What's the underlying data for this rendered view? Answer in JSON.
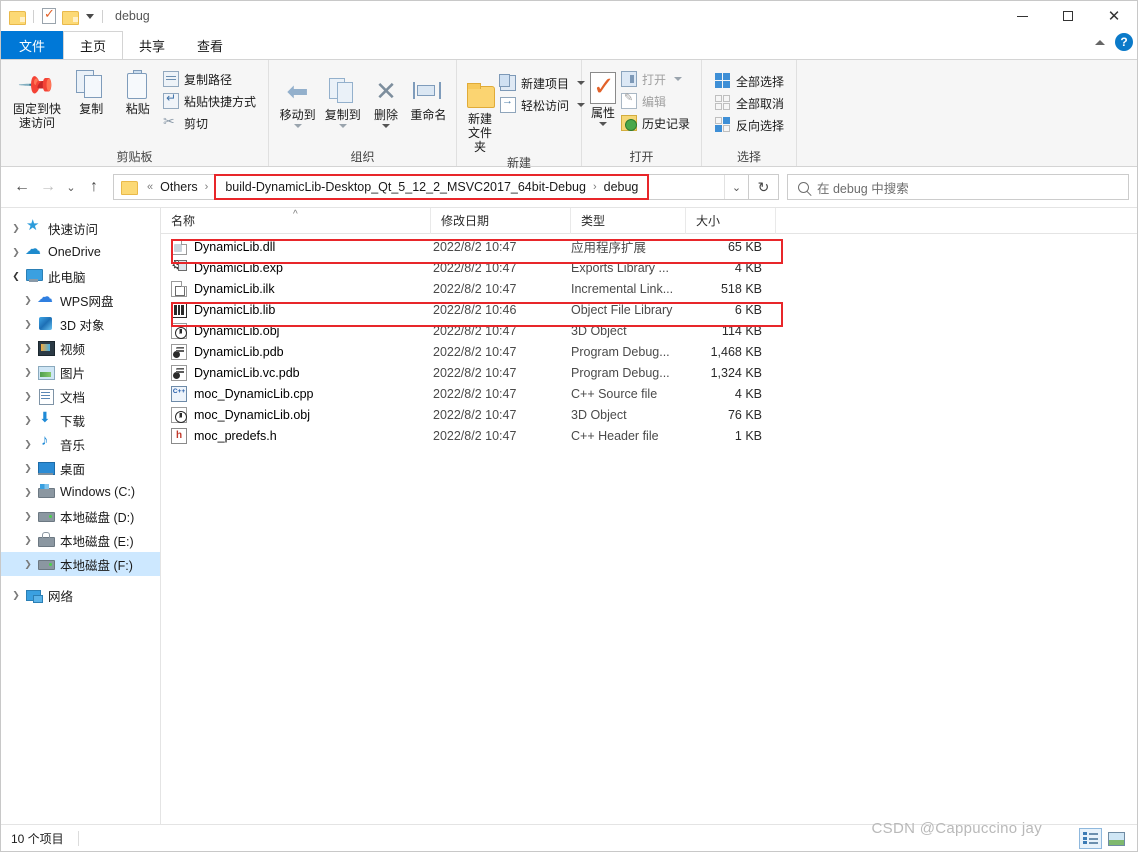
{
  "window": {
    "title": "debug",
    "quick_access_icons": [
      "folder-icon",
      "properties-icon",
      "new-folder-icon",
      "customize-caret-icon"
    ],
    "minimize": "—",
    "maximize": "□",
    "close": "✕",
    "collapse_ribbon": "^",
    "help": "?"
  },
  "tabs": [
    {
      "label": "文件",
      "name": "tab-file"
    },
    {
      "label": "主页",
      "name": "tab-home"
    },
    {
      "label": "共享",
      "name": "tab-share"
    },
    {
      "label": "查看",
      "name": "tab-view"
    }
  ],
  "ribbon": {
    "groups": [
      {
        "label": "剪贴板",
        "name": "group-clipboard",
        "big_buttons": [
          {
            "label_line1": "固定到快",
            "label_line2": "速访问",
            "icon": "pin-icon",
            "name": "pin-to-quick-access-button"
          },
          {
            "label_line1": "复制",
            "label_line2": "",
            "icon": "copy-icon",
            "name": "copy-button"
          },
          {
            "label_line1": "粘贴",
            "label_line2": "",
            "icon": "paste-icon",
            "name": "paste-button"
          }
        ],
        "small_buttons": [
          {
            "label": "复制路径",
            "icon": "copy-path-icon",
            "name": "copy-path-button"
          },
          {
            "label": "粘贴快捷方式",
            "icon": "paste-shortcut-icon",
            "name": "paste-shortcut-button"
          },
          {
            "label": "剪切",
            "icon": "scissors-icon",
            "name": "cut-button"
          }
        ]
      },
      {
        "label": "组织",
        "name": "group-organize",
        "big_buttons": [
          {
            "label_line1": "移动到",
            "label_line2": "",
            "icon": "move-to-icon",
            "name": "move-to-button"
          },
          {
            "label_line1": "复制到",
            "label_line2": "",
            "icon": "copy-to-icon",
            "name": "copy-to-button"
          },
          {
            "label_line1": "删除",
            "label_line2": "",
            "icon": "delete-icon",
            "name": "delete-button"
          },
          {
            "label_line1": "重命名",
            "label_line2": "",
            "icon": "rename-icon",
            "name": "rename-button"
          }
        ],
        "small_buttons": []
      },
      {
        "label": "新建",
        "name": "group-new",
        "big_buttons": [
          {
            "label_line1": "新建",
            "label_line2": "文件夹",
            "icon": "new-folder-icon",
            "name": "new-folder-button"
          }
        ],
        "small_buttons": [
          {
            "label": "新建项目",
            "icon": "new-item-icon",
            "name": "new-item-button"
          },
          {
            "label": "轻松访问",
            "icon": "easy-access-icon",
            "name": "easy-access-button"
          }
        ]
      },
      {
        "label": "打开",
        "name": "group-open",
        "big_buttons": [
          {
            "label_line1": "属性",
            "label_line2": "",
            "icon": "properties-icon",
            "name": "properties-button"
          }
        ],
        "small_buttons": [
          {
            "label": "打开",
            "icon": "open-icon",
            "name": "open-button"
          },
          {
            "label": "编辑",
            "icon": "edit-icon",
            "name": "edit-button"
          },
          {
            "label": "历史记录",
            "icon": "history-icon",
            "name": "history-button"
          }
        ]
      },
      {
        "label": "选择",
        "name": "group-select",
        "big_buttons": [],
        "small_buttons": [
          {
            "label": "全部选择",
            "icon": "select-all-icon",
            "name": "select-all-button"
          },
          {
            "label": "全部取消",
            "icon": "select-none-icon",
            "name": "select-none-button"
          },
          {
            "label": "反向选择",
            "icon": "invert-selection-icon",
            "name": "invert-selection-button"
          }
        ]
      }
    ]
  },
  "address": {
    "back": "←",
    "forward": "→",
    "recent": "⌄",
    "up": "↑",
    "crumbs_prefix": "«",
    "crumb_others": "Others",
    "crumb_build": "build-DynamicLib-Desktop_Qt_5_12_2_MSVC2017_64bit-Debug",
    "crumb_debug": "debug",
    "separator": "›",
    "dropdown": "⌄",
    "refresh": "↻"
  },
  "search": {
    "placeholder": "在 debug 中搜索",
    "icon": "search-icon"
  },
  "sidebar": {
    "items": [
      {
        "label": "快速访问",
        "icon": "quick-access-star-icon",
        "indent": 0,
        "expandable": true,
        "expanded": false,
        "selected": false,
        "name": "sidebar-item-quick-access"
      },
      {
        "label": "OneDrive",
        "icon": "onedrive-cloud-icon",
        "indent": 0,
        "expandable": true,
        "expanded": false,
        "selected": false,
        "name": "sidebar-item-onedrive"
      },
      {
        "label": "此电脑",
        "icon": "this-pc-icon",
        "indent": 0,
        "expandable": true,
        "expanded": true,
        "selected": false,
        "name": "sidebar-item-this-pc"
      },
      {
        "label": "WPS网盘",
        "icon": "wps-cloud-icon",
        "indent": 1,
        "expandable": true,
        "expanded": false,
        "selected": false,
        "name": "sidebar-item-wps-cloud"
      },
      {
        "label": "3D 对象",
        "icon": "3d-objects-icon",
        "indent": 1,
        "expandable": true,
        "expanded": false,
        "selected": false,
        "name": "sidebar-item-3d-objects"
      },
      {
        "label": "视频",
        "icon": "videos-icon",
        "indent": 1,
        "expandable": true,
        "expanded": false,
        "selected": false,
        "name": "sidebar-item-videos"
      },
      {
        "label": "图片",
        "icon": "pictures-icon",
        "indent": 1,
        "expandable": true,
        "expanded": false,
        "selected": false,
        "name": "sidebar-item-pictures"
      },
      {
        "label": "文档",
        "icon": "documents-icon",
        "indent": 1,
        "expandable": true,
        "expanded": false,
        "selected": false,
        "name": "sidebar-item-documents"
      },
      {
        "label": "下载",
        "icon": "downloads-icon",
        "indent": 1,
        "expandable": true,
        "expanded": false,
        "selected": false,
        "name": "sidebar-item-downloads"
      },
      {
        "label": "音乐",
        "icon": "music-icon",
        "indent": 1,
        "expandable": true,
        "expanded": false,
        "selected": false,
        "name": "sidebar-item-music"
      },
      {
        "label": "桌面",
        "icon": "desktop-icon",
        "indent": 1,
        "expandable": true,
        "expanded": false,
        "selected": false,
        "name": "sidebar-item-desktop"
      },
      {
        "label": "Windows (C:)",
        "icon": "windows-drive-icon",
        "indent": 1,
        "expandable": true,
        "expanded": false,
        "selected": false,
        "name": "sidebar-item-drive-c"
      },
      {
        "label": "本地磁盘 (D:)",
        "icon": "drive-icon",
        "indent": 1,
        "expandable": true,
        "expanded": false,
        "selected": false,
        "name": "sidebar-item-drive-d"
      },
      {
        "label": "本地磁盘 (E:)",
        "icon": "locked-drive-icon",
        "indent": 1,
        "expandable": true,
        "expanded": false,
        "selected": false,
        "name": "sidebar-item-drive-e"
      },
      {
        "label": "本地磁盘 (F:)",
        "icon": "drive-icon",
        "indent": 1,
        "expandable": true,
        "expanded": false,
        "selected": true,
        "name": "sidebar-item-drive-f"
      },
      {
        "label": "网络",
        "icon": "network-icon",
        "indent": 0,
        "expandable": true,
        "expanded": false,
        "selected": false,
        "name": "sidebar-item-network"
      }
    ]
  },
  "filelist": {
    "columns": [
      {
        "label": "名称",
        "name": "column-name",
        "sorted": true,
        "sort_arrow": "^"
      },
      {
        "label": "修改日期",
        "name": "column-date-modified",
        "sorted": false
      },
      {
        "label": "类型",
        "name": "column-type",
        "sorted": false
      },
      {
        "label": "大小",
        "name": "column-size",
        "sorted": false
      }
    ],
    "rows": [
      {
        "name": "DynamicLib.dll",
        "date": "2022/8/2 10:47",
        "type": "应用程序扩展",
        "size": "65 KB",
        "icon": "dll-file-icon",
        "highlighted": true
      },
      {
        "name": "DynamicLib.exp",
        "date": "2022/8/2 10:47",
        "type": "Exports Library ...",
        "size": "4 KB",
        "icon": "exp-file-icon",
        "highlighted": false
      },
      {
        "name": "DynamicLib.ilk",
        "date": "2022/8/2 10:47",
        "type": "Incremental Link...",
        "size": "518 KB",
        "icon": "ilk-file-icon",
        "highlighted": false
      },
      {
        "name": "DynamicLib.lib",
        "date": "2022/8/2 10:46",
        "type": "Object File Library",
        "size": "6 KB",
        "icon": "lib-file-icon",
        "highlighted": true
      },
      {
        "name": "DynamicLib.obj",
        "date": "2022/8/2 10:47",
        "type": "3D Object",
        "size": "114 KB",
        "icon": "obj-file-icon",
        "highlighted": false
      },
      {
        "name": "DynamicLib.pdb",
        "date": "2022/8/2 10:47",
        "type": "Program Debug...",
        "size": "1,468 KB",
        "icon": "pdb-file-icon",
        "highlighted": false
      },
      {
        "name": "DynamicLib.vc.pdb",
        "date": "2022/8/2 10:47",
        "type": "Program Debug...",
        "size": "1,324 KB",
        "icon": "pdb-file-icon",
        "highlighted": false
      },
      {
        "name": "moc_DynamicLib.cpp",
        "date": "2022/8/2 10:47",
        "type": "C++ Source file",
        "size": "4 KB",
        "icon": "cpp-file-icon",
        "highlighted": false
      },
      {
        "name": "moc_DynamicLib.obj",
        "date": "2022/8/2 10:47",
        "type": "3D Object",
        "size": "76 KB",
        "icon": "obj-file-icon",
        "highlighted": false
      },
      {
        "name": "moc_predefs.h",
        "date": "2022/8/2 10:47",
        "type": "C++ Header file",
        "size": "1 KB",
        "icon": "h-file-icon",
        "highlighted": false
      }
    ]
  },
  "statusbar": {
    "item_count": "10 个项目",
    "view_details": "details-view-icon",
    "view_large_icons": "large-icons-view-icon"
  },
  "watermark": "CSDN @Cappuccino jay",
  "colors": {
    "accent": "#0078d7",
    "annotation_red": "#e8262a",
    "selection_blue": "#cde8ff",
    "folder_yellow": "#fcd975"
  }
}
